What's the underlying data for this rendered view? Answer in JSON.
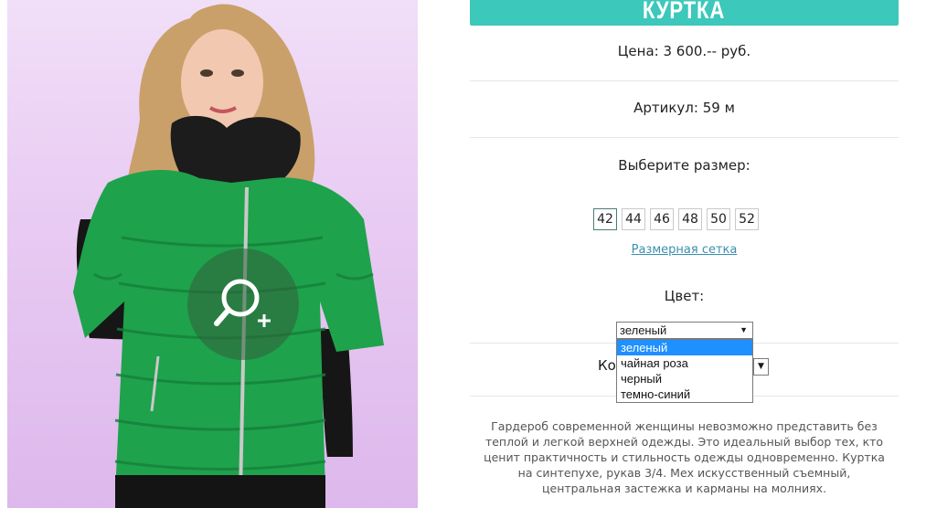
{
  "product": {
    "title": "КУРТКА",
    "price": "Цена: 3 600.-- руб.",
    "article": "Артикул: 59 м",
    "size_label": "Выберите размер:",
    "sizes": [
      "42",
      "44",
      "46",
      "48",
      "50",
      "52"
    ],
    "selected_size": "42",
    "size_chart_link": "Размерная сетка",
    "color_label": "Цвет:",
    "color_select": {
      "value": "зеленый",
      "options": [
        "зеленый",
        "чайная роза",
        "черный",
        "темно-синий"
      ]
    },
    "quantity_label_partial": "Ко",
    "description": "Гардероб современной женщины невозможно представить без теплой и легкой верхней одежды. Это идеальный выбор тех, кто ценит практичность и стильность одежды одновременно. Куртка на синтепухе, рукав 3/4. Мех искусственный съемный, центральная застежка и карманы на молниях."
  },
  "image": {
    "zoom_icon": "magnify-plus-icon",
    "jacket_color": "#1fa24c",
    "background_color": "#e8caf2"
  },
  "colors": {
    "accent": "#3cc8bb",
    "link": "#3a8fb0",
    "dropdown_highlight": "#1e90ff"
  }
}
